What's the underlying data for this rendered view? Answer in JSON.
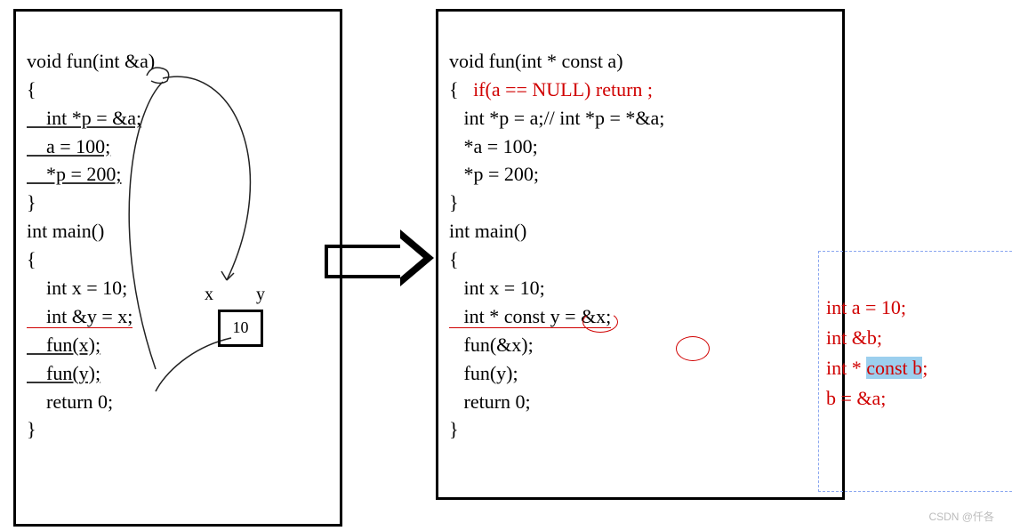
{
  "left_code": {
    "l1": "void fun(int &a)",
    "l2": "{",
    "l3": "    int *p = &a;",
    "l4": "    a = 100;",
    "l5": "    *p = 200;",
    "l6": "}",
    "l7": "int main()",
    "l8": "{",
    "l9": "    int x = 10;",
    "l10": "    int &y = x;",
    "l11": "    fun(x);",
    "l12": "    fun(y);",
    "l13": "    return 0;",
    "l14": "}"
  },
  "right_code": {
    "l1": "void fun(int * const a)",
    "l2": "{",
    "l2r": "   if(a == NULL) return ;",
    "l3": "   int *p = a;// int *p = *&a;",
    "l4": "   *a = 100;",
    "l5": "   *p = 200;",
    "l6": "}",
    "l7": "int main()",
    "l8": "{",
    "l9": "   int x = 10;",
    "l10": "   int * const y = &x;",
    "l11": "   fun(&x);",
    "l12": "   fun(y);",
    "l13": "   return 0;",
    "l14": "}"
  },
  "side_box": {
    "l1": "int a = 10;",
    "l2": "int &b;",
    "l3_pre": "int * ",
    "l3_hl": "const b",
    "l3_post": ";",
    "l4": "b = &a;"
  },
  "memory": {
    "label_x": "x",
    "label_y": "y",
    "value": "10"
  },
  "watermark": "CSDN @仟各"
}
